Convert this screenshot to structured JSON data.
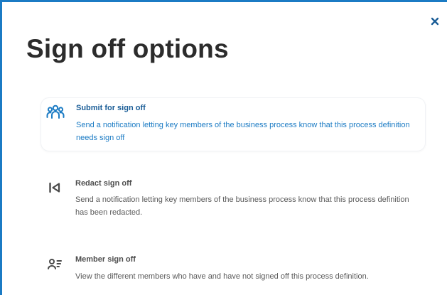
{
  "dialog": {
    "title": "Sign off options",
    "close_icon": "close-icon"
  },
  "options": [
    {
      "label": "Submit for sign off",
      "description": "Send a notification letting key members of the business process know that this process definition needs sign off",
      "icon": "group-users-icon",
      "selected": true
    },
    {
      "label": "Redact sign off",
      "description": "Send a notification letting key members of the business process know that this process definition has been redacted.",
      "icon": "skip-back-icon",
      "selected": false
    },
    {
      "label": "Member sign off",
      "description": "View the different members who have and have not signed off this process definition.",
      "icon": "member-list-icon",
      "selected": false
    }
  ],
  "colors": {
    "accent": "#1b7bc4",
    "title": "#2c2c2c",
    "selected_label": "#1a5d97",
    "muted_text": "#5a5a5a",
    "icon_dark": "#4a4a4a"
  }
}
